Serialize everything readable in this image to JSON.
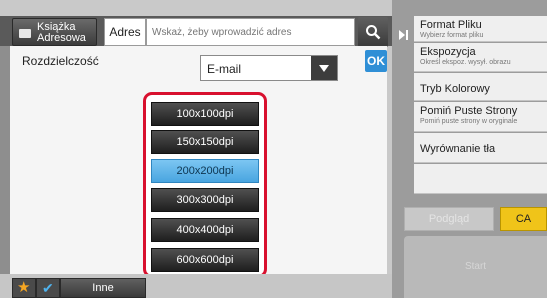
{
  "header": {
    "address_book_label": "Książka Adresowa",
    "address_label": "Adres",
    "search_placeholder": "Wskaż, żeby wprowadzić adres"
  },
  "main": {
    "resolution_label": "Rozdzielczość",
    "mode_value": "E-mail",
    "ok_label": "OK",
    "resolution_options": [
      "100x100dpi",
      "150x150dpi",
      "200x200dpi",
      "300x300dpi",
      "400x400dpi",
      "600x600dpi"
    ],
    "selected_option": "200x200dpi"
  },
  "sidebar": {
    "items": [
      {
        "title": "Format Pliku",
        "subtitle": "Wybierz format pliku"
      },
      {
        "title": "Ekspozycja",
        "subtitle": "Określ ekspoz. wysył. obrazu"
      },
      {
        "title": "Tryb Kolorowy",
        "subtitle": ""
      },
      {
        "title": "Pomiń Puste Strony",
        "subtitle": "Pomiń puste strony w oryginale"
      },
      {
        "title": "Wyrównanie tła",
        "subtitle": ""
      }
    ],
    "preview_label": "Podgląd",
    "ca_label": "CA",
    "start_label": "Start"
  },
  "footer": {
    "other_label": "Inne"
  },
  "colors": {
    "accent": "#2f8fd6",
    "highlight": "#d8102e",
    "ca": "#f0c419"
  }
}
